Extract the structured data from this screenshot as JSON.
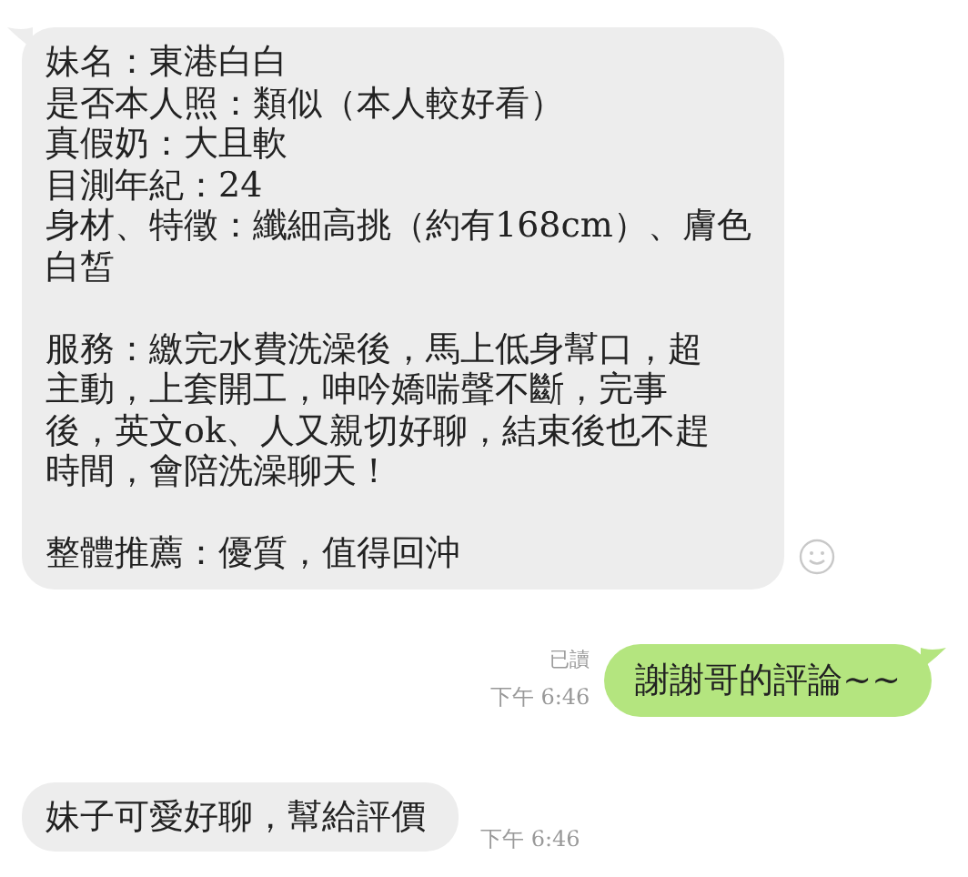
{
  "messages": [
    {
      "kind": "incoming",
      "paragraphs": [
        [
          "妹名：東港白白",
          "是否本人照：類似（本人較好看）",
          "真假奶：大且軟",
          "目測年紀：24",
          "身材、特徵：纖細高挑（約有168cm）、膚色",
          "白皙"
        ],
        [
          "服務：繳完水費洗澡後，馬上低身幫口，超",
          "主動，上套開工，呻吟嬌喘聲不斷，完事",
          "後，英文ok、人又親切好聊，結束後也不趕",
          "時間，會陪洗澡聊天！"
        ],
        [
          "整體推薦：優質，值得回沖"
        ]
      ],
      "tail": true,
      "reaction": true
    },
    {
      "kind": "outgoing",
      "paragraphs": [
        [
          "謝謝哥的評論~~"
        ]
      ],
      "tail": true,
      "read": "已讀",
      "time": "下午 6:46"
    },
    {
      "kind": "incoming",
      "paragraphs": [
        [
          "妹子可愛好聊，幫給評價"
        ]
      ],
      "tail": false,
      "reaction": false,
      "time": "下午 6:46"
    }
  ]
}
